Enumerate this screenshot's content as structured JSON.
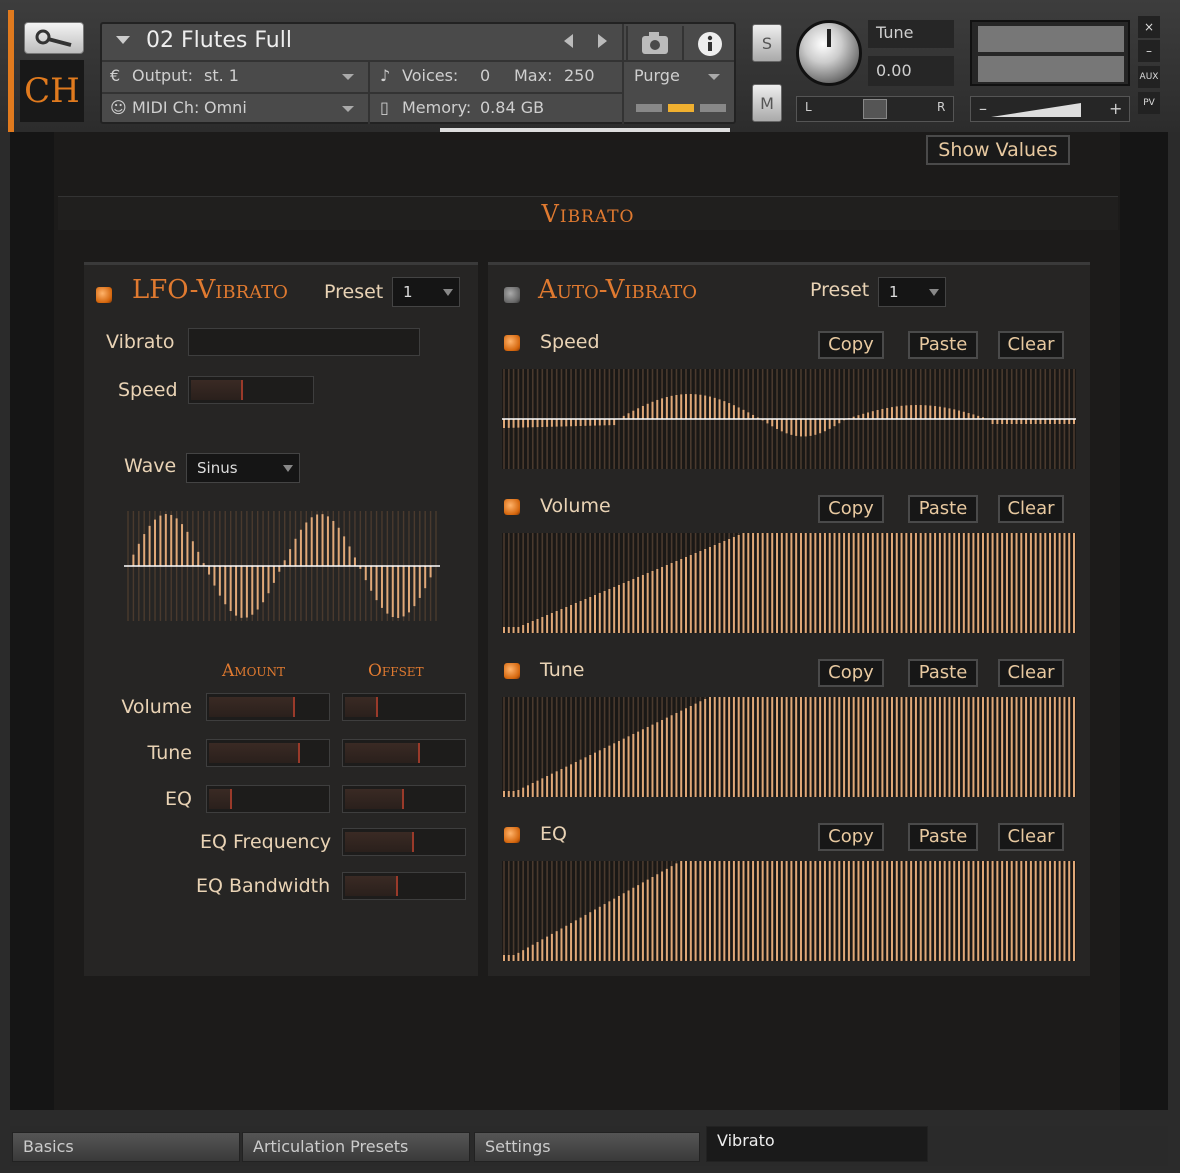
{
  "header": {
    "logo": "CH",
    "instrument_name": "02 Flutes Full",
    "output_label": "Output:",
    "output_value": "st. 1",
    "voices_label": "Voices:",
    "voices_value": "0",
    "max_label": "Max:",
    "max_value": "250",
    "purge_label": "Purge",
    "midi_label": "MIDI Ch:",
    "midi_value": "Omni",
    "memory_label": "Memory:",
    "memory_value": "0.84 GB",
    "solo_label": "S",
    "mute_label": "M",
    "tune_label": "Tune",
    "tune_value": "0.00",
    "pan_left": "L",
    "pan_right": "R",
    "vol_minus": "–",
    "vol_plus": "+",
    "close_label": "×",
    "minimize_label": "–",
    "aux_label": "AUX",
    "pv_label": "PV",
    "output_icon": "euro-icon",
    "voices_icon": "voices-icon",
    "midi_icon": "midi-icon",
    "memory_icon": "memory-icon"
  },
  "show_values_label": "Show Values",
  "section_title": "Vibrato",
  "lfo": {
    "title": "LFO-Vibrato",
    "preset_label": "Preset",
    "preset_value": "1",
    "vibrato_label": "Vibrato",
    "vibrato_level": 0.0,
    "speed_label": "Speed",
    "speed_level": 0.45,
    "wave_label": "Wave",
    "wave_value": "Sinus",
    "amount_label": "Amount",
    "offset_label": "Offset",
    "rows": [
      {
        "label": "Volume",
        "amount": 0.74,
        "offset": 0.3
      },
      {
        "label": "Tune",
        "amount": 0.78,
        "offset": 0.65
      },
      {
        "label": "EQ",
        "amount": 0.22,
        "offset": 0.52
      }
    ],
    "eq_frequency_label": "EQ Frequency",
    "eq_frequency_level": 0.6,
    "eq_bandwidth_label": "EQ Bandwidth",
    "eq_bandwidth_level": 0.47
  },
  "auto": {
    "title": "Auto-Vibrato",
    "preset_label": "Preset",
    "preset_value": "1",
    "copy_label": "Copy",
    "paste_label": "Paste",
    "clear_label": "Clear",
    "lanes": [
      {
        "label": "Speed"
      },
      {
        "label": "Volume"
      },
      {
        "label": "Tune"
      },
      {
        "label": "EQ"
      }
    ]
  },
  "tabs": [
    "Basics",
    "Articulation Presets",
    "Settings",
    "Vibrato"
  ],
  "active_tab": "Vibrato",
  "colors": {
    "accent": "#e07a30",
    "bar": "#e0a878"
  }
}
